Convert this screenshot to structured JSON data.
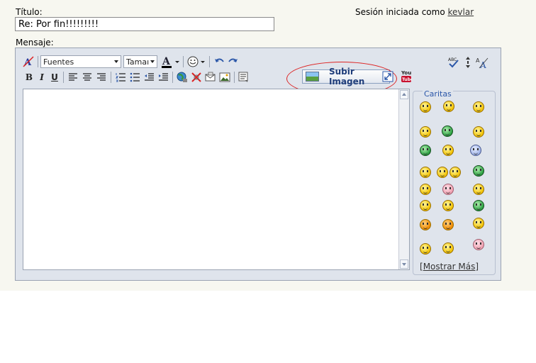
{
  "form": {
    "title_label": "Título:",
    "title_value": "Re: Por fin!!!!!!!!!",
    "message_label": "Mensaje:",
    "session_text": "Sesión iniciada como",
    "session_user": "kevlar"
  },
  "toolbar": {
    "font_select": "Fuentes",
    "size_select": "Tamaı",
    "upload_label": "Subir Imagen",
    "youtube_label": "You"
  },
  "smileys": {
    "title": "Caritas",
    "show_more_open": "[",
    "show_more": "Mostrar Más",
    "show_more_close": "]"
  },
  "colors": {
    "accent": "#2a56a8",
    "highlight_oval": "#dd2222"
  }
}
